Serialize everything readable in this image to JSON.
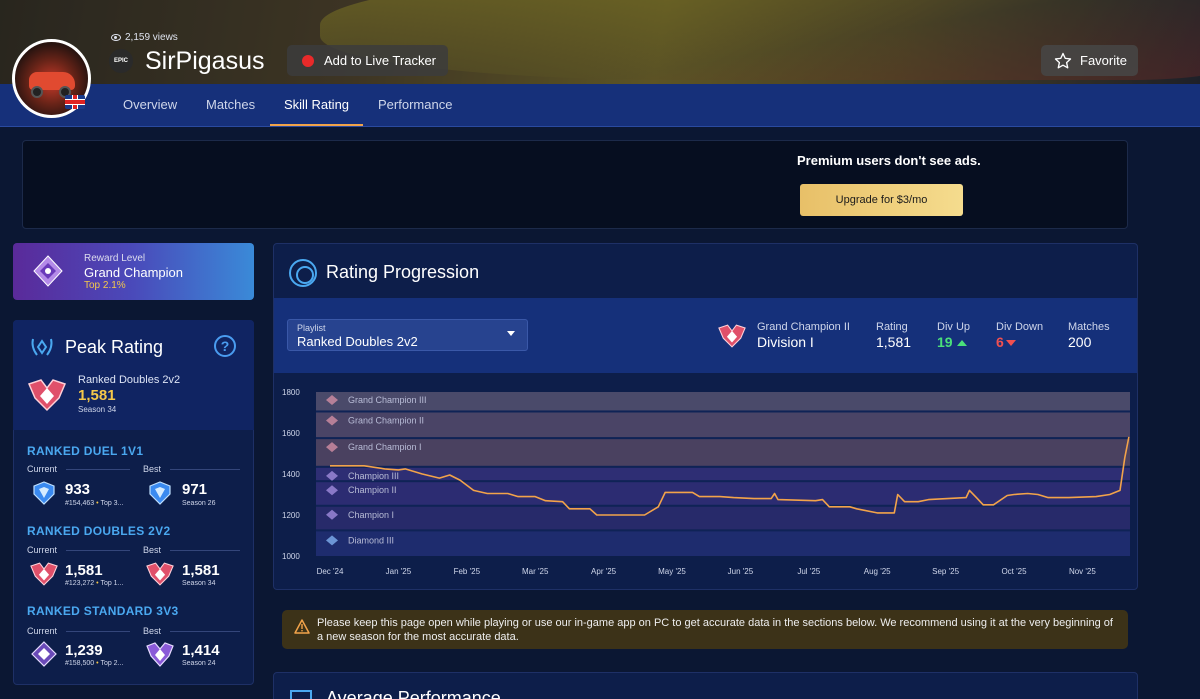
{
  "profile": {
    "views": "2,159 views",
    "platform_icon": "epic-games-icon",
    "platform_label": "EPIC",
    "name": "SirPigasus",
    "country_flag": "uk-flag-icon"
  },
  "header": {
    "live_tracker_label": "Add to Live Tracker",
    "favorite_label": "Favorite"
  },
  "tabs": [
    {
      "label": "Overview",
      "active": false
    },
    {
      "label": "Matches",
      "active": false
    },
    {
      "label": "Skill Rating",
      "active": true
    },
    {
      "label": "Performance",
      "active": false
    }
  ],
  "ad": {
    "text": "Premium users don't see ads.",
    "upgrade_label": "Upgrade for $3/mo"
  },
  "reward": {
    "label": "Reward Level",
    "rank": "Grand Champion",
    "top": "Top 2.1%"
  },
  "peak": {
    "title": "Peak Rating",
    "help": "?",
    "playlist": "Ranked Doubles 2v2",
    "rating": "1,581",
    "season": "Season 34"
  },
  "ranked": [
    {
      "title": "RANKED DUEL 1V1",
      "current_label": "Current",
      "best_label": "Best",
      "current_value": "933",
      "current_rank": "#154,463",
      "current_top": "Top 3...",
      "best_value": "971",
      "best_season": "Season 26",
      "tier": "diamond"
    },
    {
      "title": "RANKED DOUBLES 2V2",
      "current_label": "Current",
      "best_label": "Best",
      "current_value": "1,581",
      "current_rank": "#123,272",
      "current_top": "Top 1...",
      "best_value": "1,581",
      "best_season": "Season 34",
      "tier": "grand-champion"
    },
    {
      "title": "RANKED STANDARD 3V3",
      "current_label": "Current",
      "best_label": "Best",
      "current_value": "1,239",
      "current_rank": "#158,500",
      "current_top": "Top 2...",
      "best_value": "1,414",
      "best_season": "Season 24",
      "tier": "champion"
    }
  ],
  "rating_progression": {
    "title": "Rating Progression",
    "playlist_label": "Playlist",
    "playlist_value": "Ranked Doubles 2v2",
    "rank_name": "Grand Champion II",
    "division": "Division I",
    "rating_label": "Rating",
    "rating_value": "1,581",
    "div_up_label": "Div Up",
    "div_up_value": "19",
    "div_down_label": "Div Down",
    "div_down_value": "6",
    "matches_label": "Matches",
    "matches_value": "200"
  },
  "chart_data": {
    "type": "line",
    "ylim": [
      1000,
      1800
    ],
    "y_ticks": [
      "1800",
      "1600",
      "1400",
      "1200",
      "1000"
    ],
    "x_ticks": [
      "Dec '24",
      "Jan '25",
      "Feb '25",
      "Mar '25",
      "Apr '25",
      "May '25",
      "Jun '25",
      "Jul '25",
      "Aug '25",
      "Sep '25",
      "Oct '25",
      "Nov '25"
    ],
    "rank_bands": [
      {
        "name": "Grand Champion III",
        "min": 1710,
        "max": 1800
      },
      {
        "name": "Grand Champion II",
        "min": 1580,
        "max": 1700
      },
      {
        "name": "Grand Champion I",
        "min": 1440,
        "max": 1570
      },
      {
        "name": "Champion III",
        "min": 1370,
        "max": 1430
      },
      {
        "name": "Champion II",
        "min": 1250,
        "max": 1360
      },
      {
        "name": "Champion I",
        "min": 1130,
        "max": 1240
      },
      {
        "name": "Diamond III",
        "min": 1000,
        "max": 1120
      }
    ],
    "line_color": "#f2a34a",
    "series": [
      {
        "values": [
          [
            0,
            1440
          ],
          [
            0.5,
            1440
          ],
          [
            0.8,
            1425
          ],
          [
            1.0,
            1420
          ],
          [
            1.1,
            1425
          ],
          [
            1.35,
            1400
          ],
          [
            1.6,
            1380
          ],
          [
            1.75,
            1395
          ],
          [
            1.9,
            1370
          ],
          [
            2.1,
            1320
          ],
          [
            2.3,
            1305
          ],
          [
            2.6,
            1305
          ],
          [
            2.75,
            1290
          ],
          [
            3.0,
            1290
          ],
          [
            3.15,
            1270
          ],
          [
            3.4,
            1265
          ],
          [
            3.5,
            1230
          ],
          [
            3.8,
            1230
          ],
          [
            3.9,
            1200
          ],
          [
            4.6,
            1200
          ],
          [
            4.8,
            1240
          ],
          [
            4.9,
            1310
          ],
          [
            5.3,
            1310
          ],
          [
            5.4,
            1290
          ],
          [
            5.7,
            1290
          ],
          [
            5.9,
            1285
          ],
          [
            6.2,
            1280
          ],
          [
            6.45,
            1280
          ],
          [
            6.5,
            1305
          ],
          [
            6.55,
            1275
          ],
          [
            7.1,
            1270
          ],
          [
            7.2,
            1275
          ],
          [
            7.3,
            1240
          ],
          [
            7.6,
            1240
          ],
          [
            7.7,
            1230
          ],
          [
            8.0,
            1210
          ],
          [
            8.25,
            1210
          ],
          [
            8.3,
            1300
          ],
          [
            8.4,
            1265
          ],
          [
            8.6,
            1265
          ],
          [
            8.75,
            1275
          ],
          [
            9.3,
            1285
          ],
          [
            9.35,
            1320
          ],
          [
            9.45,
            1285
          ],
          [
            9.55,
            1250
          ],
          [
            9.7,
            1250
          ],
          [
            9.9,
            1295
          ],
          [
            10.0,
            1300
          ],
          [
            10.2,
            1305
          ],
          [
            10.35,
            1300
          ],
          [
            10.5,
            1285
          ],
          [
            10.8,
            1285
          ],
          [
            11.2,
            1290
          ],
          [
            11.4,
            1300
          ],
          [
            11.55,
            1320
          ],
          [
            11.62,
            1480
          ],
          [
            11.68,
            1581
          ]
        ]
      }
    ]
  },
  "notice": {
    "text": "Please keep this page open while playing or use our in-game app on PC to get accurate data in the sections below. We recommend using it at the very beginning of a new season for the most accurate data."
  },
  "average_performance": {
    "title": "Average Performance"
  }
}
